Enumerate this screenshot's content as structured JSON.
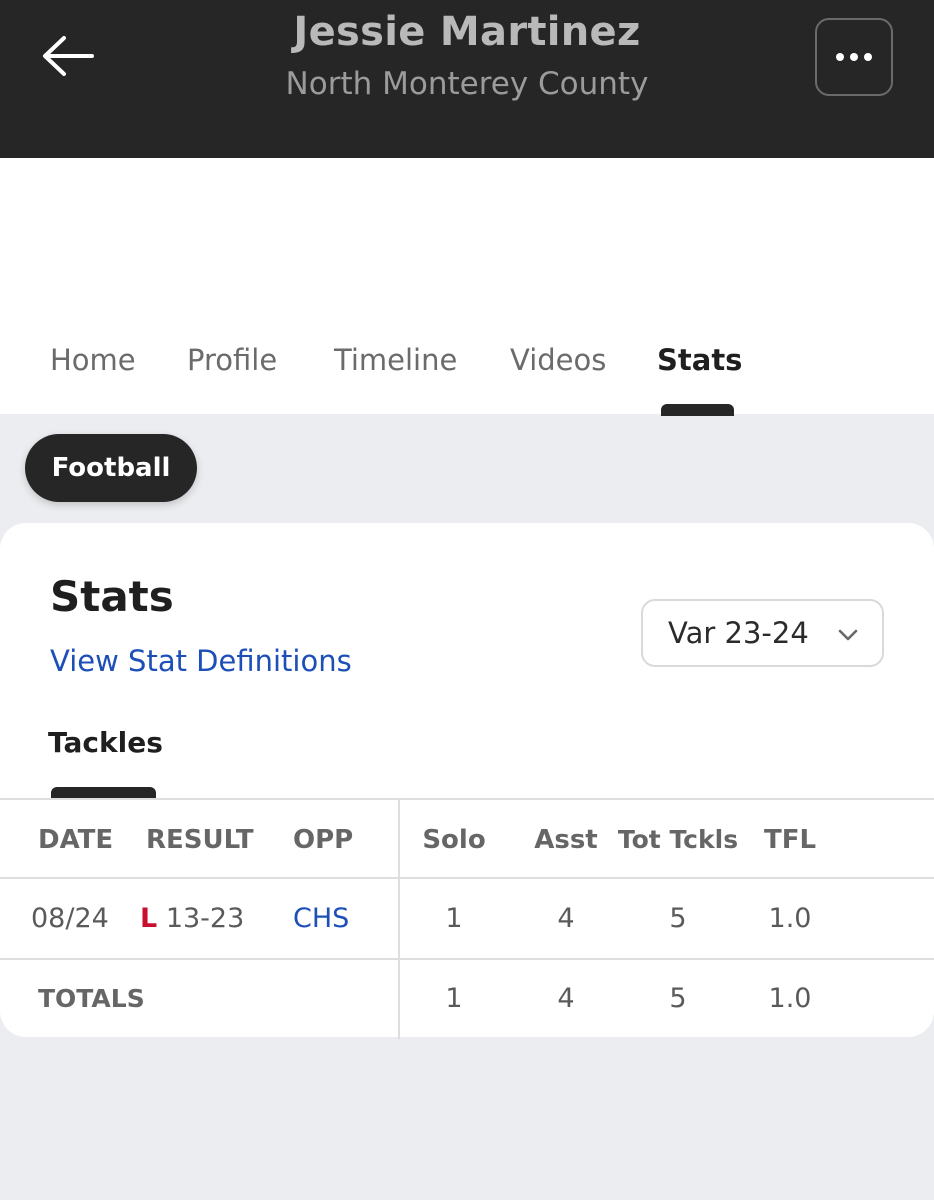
{
  "header": {
    "player_name": "Jessie Martinez",
    "school": "North Monterey County",
    "back_icon": "arrow-left-icon",
    "more_icon": "ellipsis-icon"
  },
  "tabs": [
    {
      "label": "Home",
      "active": false
    },
    {
      "label": "Profile",
      "active": false
    },
    {
      "label": "Timeline",
      "active": false
    },
    {
      "label": "Videos",
      "active": false
    },
    {
      "label": "Stats",
      "active": true
    }
  ],
  "sport_filter": {
    "label": "Football"
  },
  "stats_card": {
    "title": "Stats",
    "definitions_link": "View Stat Definitions",
    "season_select": {
      "value": "Var 23-24",
      "icon": "chevron-down-icon"
    },
    "category_tab": "Tackles"
  },
  "table": {
    "headers": {
      "date": "DATE",
      "result": "RESULT",
      "opp": "OPP",
      "solo": "Solo",
      "asst": "Asst",
      "tot": "Tot Tckls",
      "tfl": "TFL"
    },
    "rows": [
      {
        "date": "08/24",
        "result_outcome": "L",
        "result_score": "13-23",
        "opp": "CHS",
        "solo": "1",
        "asst": "4",
        "tot": "5",
        "tfl": "1.0"
      }
    ],
    "totals": {
      "label": "TOTALS",
      "solo": "1",
      "asst": "4",
      "tot": "5",
      "tfl": "1.0"
    }
  },
  "colors": {
    "topbar": "#262626",
    "link": "#1c4fb8",
    "loss": "#c8102e",
    "page_bg": "#ecedf0"
  }
}
